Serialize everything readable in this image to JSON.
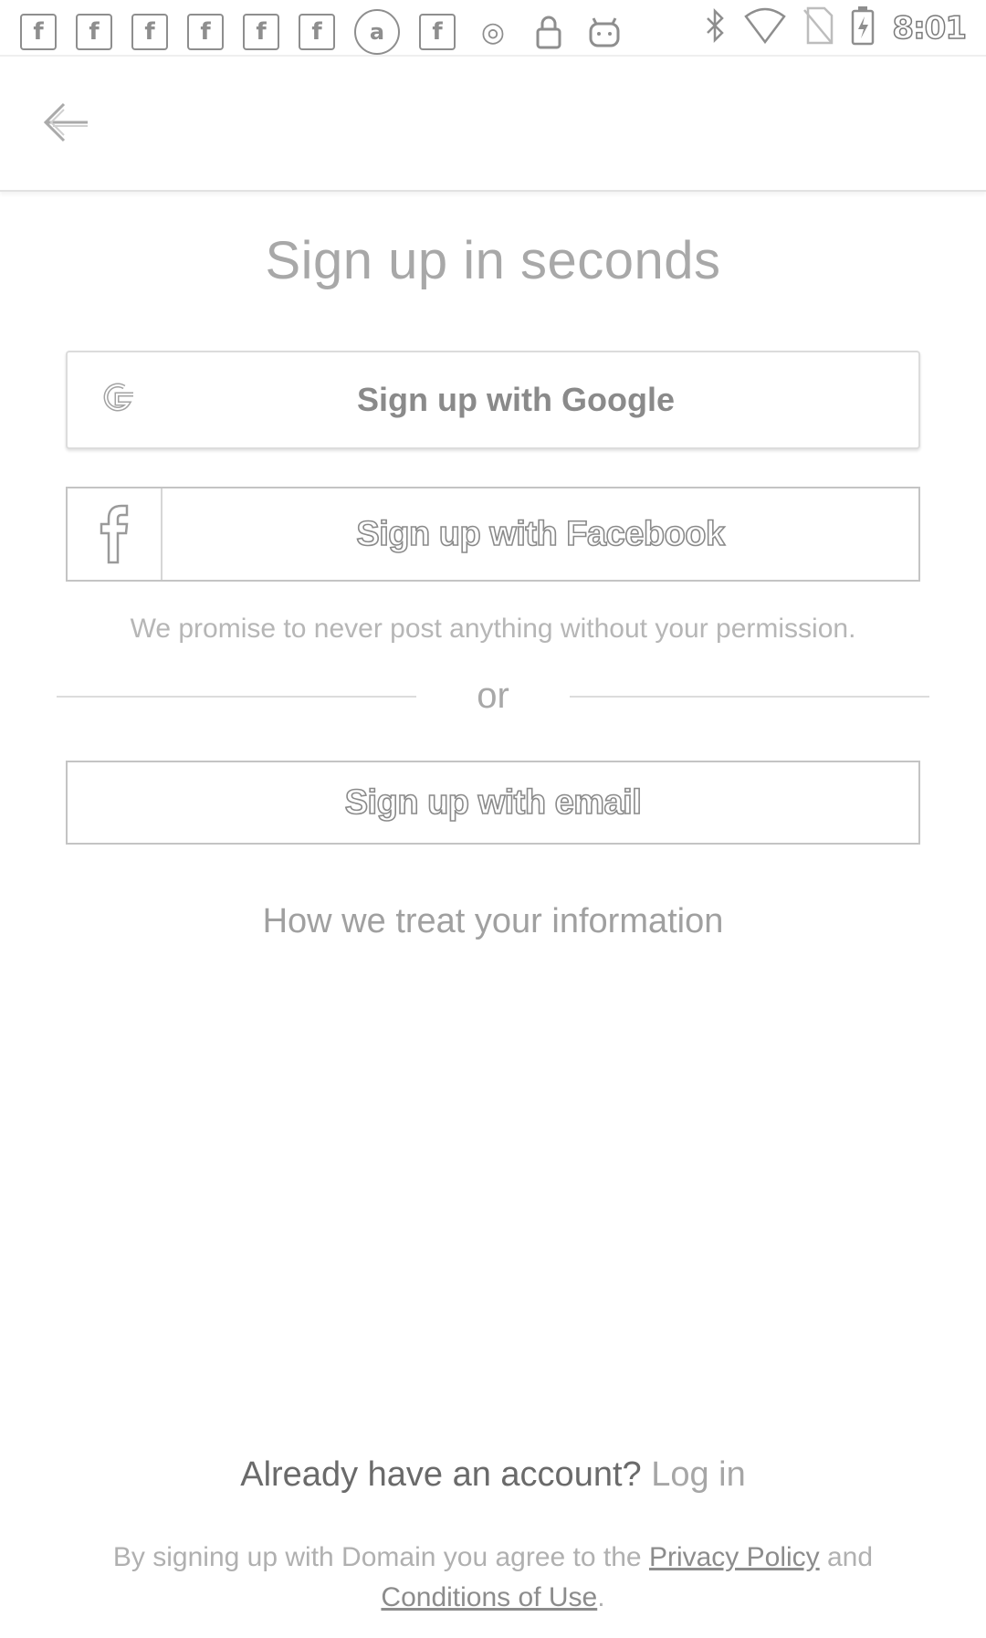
{
  "status_bar": {
    "notification_icons": [
      {
        "icon": "facebook-notification-icon",
        "glyph": "f"
      },
      {
        "icon": "facebook-notification-icon",
        "glyph": "f"
      },
      {
        "icon": "facebook-notification-icon",
        "glyph": "f"
      },
      {
        "icon": "facebook-notification-icon",
        "glyph": "f"
      },
      {
        "icon": "facebook-notification-icon",
        "glyph": "f"
      },
      {
        "icon": "facebook-notification-icon",
        "glyph": "f"
      },
      {
        "icon": "app-notification-icon",
        "glyph": "a"
      },
      {
        "icon": "facebook-notification-icon",
        "glyph": "f"
      },
      {
        "icon": "circle-notification-icon",
        "glyph": "◎"
      },
      {
        "icon": "lock-icon",
        "glyph": "🔒"
      },
      {
        "icon": "android-icon",
        "glyph": "☺"
      }
    ],
    "system_icons": [
      "bluetooth-icon",
      "wifi-icon",
      "no-sim-icon",
      "battery-charging-icon"
    ],
    "time": "8:01"
  },
  "appbar": {
    "back_icon": "arrow-left-icon"
  },
  "signup": {
    "title": "Sign up in seconds",
    "google_label": "Sign up with Google",
    "google_icon": "google-icon",
    "facebook_label": "Sign up with Facebook",
    "facebook_icon": "facebook-icon",
    "promise_text": "We promise to never post anything without your permission.",
    "or_text": "or",
    "email_label": "Sign up with email",
    "info_link": "How we treat your information"
  },
  "footer": {
    "account_prompt": "Already have an account?",
    "login_link": "Log in",
    "legal_prefix": "By signing up with Domain you agree to the",
    "privacy_link": "Privacy Policy",
    "legal_and": "and",
    "conditions_link": "Conditions of Use",
    "legal_suffix": "."
  },
  "colors": {
    "background": "#ffffff",
    "text_muted": "#a8a8a8",
    "border": "#c4c4c4"
  }
}
